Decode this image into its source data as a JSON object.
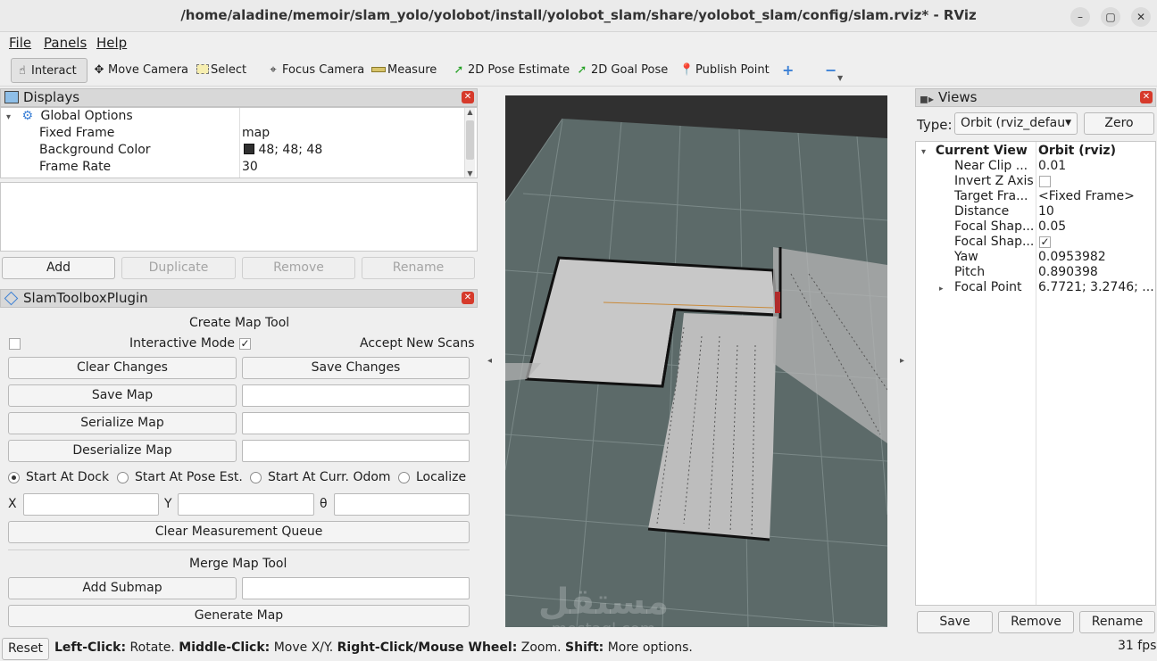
{
  "window": {
    "title": "/home/aladine/memoir/slam_yolo/yolobot/install/yolobot_slam/share/yolobot_slam/config/slam.rviz* - RViz",
    "controls": {
      "minimize": "–",
      "restore": "▢",
      "close": "✕"
    }
  },
  "menu": {
    "file": "File",
    "panels": "Panels",
    "help": "Help"
  },
  "toolbar": {
    "interact": "Interact",
    "move_camera": "Move Camera",
    "select": "Select",
    "focus_camera": "Focus Camera",
    "measure": "Measure",
    "pose_estimate": "2D Pose Estimate",
    "goal_pose": "2D Goal Pose",
    "publish_point": "Publish Point",
    "add_tool": "+",
    "remove_tool": "−"
  },
  "displays": {
    "title": "Displays",
    "global_options": "Global Options",
    "properties": [
      {
        "name": "Fixed Frame",
        "value": "map"
      },
      {
        "name": "Background Color",
        "value": "48; 48; 48",
        "swatch": "#303030"
      },
      {
        "name": "Frame Rate",
        "value": "30"
      }
    ],
    "buttons": {
      "add": "Add",
      "duplicate": "Duplicate",
      "remove": "Remove",
      "rename": "Rename"
    }
  },
  "slam": {
    "title": "SlamToolboxPlugin",
    "create_map_tool": "Create Map Tool",
    "interactive_mode": "Interactive Mode",
    "interactive_mode_checked": true,
    "left_checkbox_checked": false,
    "accept_new_scans": "Accept New Scans",
    "clear_changes": "Clear Changes",
    "save_changes": "Save Changes",
    "save_map": "Save Map",
    "serialize_map": "Serialize Map",
    "deserialize_map": "Deserialize Map",
    "start_options": [
      "Start At Dock",
      "Start At Pose Est.",
      "Start At Curr. Odom",
      "Localize"
    ],
    "selected_start": 0,
    "x_label": "X",
    "y_label": "Y",
    "theta_label": "θ",
    "clear_measurement_queue": "Clear Measurement Queue",
    "merge_map_tool": "Merge Map Tool",
    "add_submap": "Add Submap",
    "generate_map": "Generate Map"
  },
  "views": {
    "title": "Views",
    "type_label": "Type:",
    "type_value": "Orbit (rviz_defau",
    "zero": "Zero",
    "current_view": "Current View",
    "current_view_value": "Orbit (rviz)",
    "properties": [
      {
        "name": "Near Clip ...",
        "value": "0.01"
      },
      {
        "name": "Invert Z Axis",
        "value": "",
        "checkbox": false
      },
      {
        "name": "Target Fra...",
        "value": "<Fixed Frame>"
      },
      {
        "name": "Distance",
        "value": "10"
      },
      {
        "name": "Focal Shap...",
        "value": "0.05"
      },
      {
        "name": "Focal Shap...",
        "value": "",
        "checkbox": true
      },
      {
        "name": "Yaw",
        "value": "0.0953982"
      },
      {
        "name": "Pitch",
        "value": "0.890398"
      },
      {
        "name": "Focal Point",
        "value": "6.7721; 3.2746; ..."
      }
    ],
    "buttons": {
      "save": "Save",
      "remove": "Remove",
      "rename": "Rename"
    }
  },
  "status": {
    "reset": "Reset",
    "left_click": "Left-Click:",
    "rotate": " Rotate. ",
    "middle_click": "Middle-Click:",
    "move_xy": " Move X/Y. ",
    "right_click": "Right-Click/Mouse Wheel:",
    "zoom": " Zoom. ",
    "shift": "Shift:",
    "more_options": " More options.",
    "fps": "31 fps"
  },
  "watermark": {
    "arabic": "مستقل",
    "latin": "mostaql.com"
  },
  "colors": {
    "grid_plane": "#5c6a69",
    "map_free": "#c8c8c8",
    "background": "#303030",
    "close_red": "#d63a2b"
  }
}
